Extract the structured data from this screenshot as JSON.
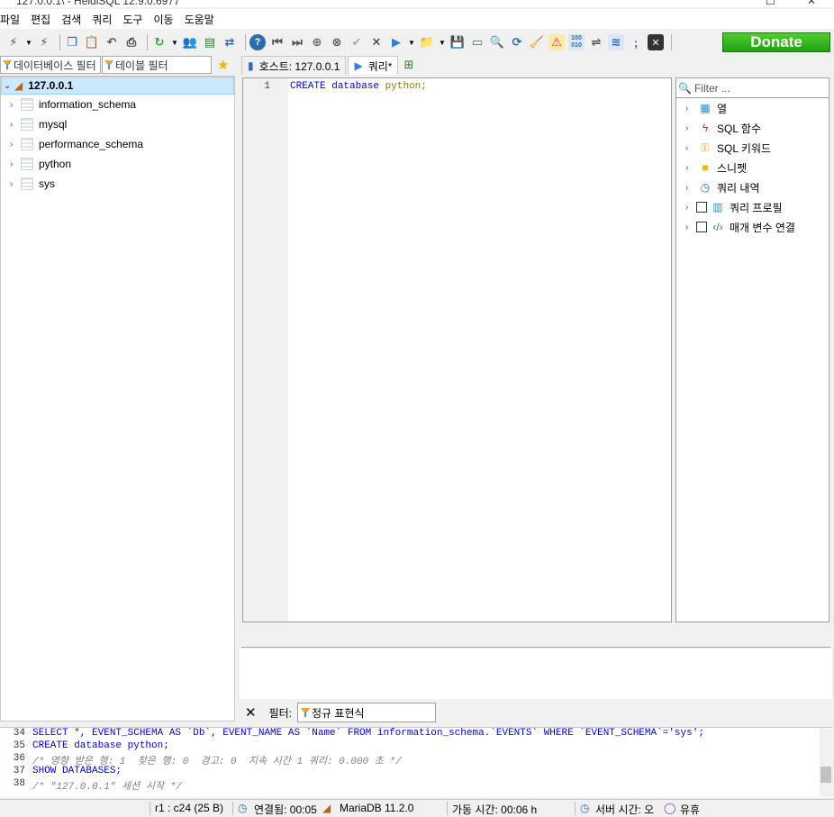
{
  "titlebar": {
    "title": "127.0.0.1\\ - HeidiSQL 12.9.0.6977",
    "restore": "☐",
    "close": "✕"
  },
  "menu": [
    "파일",
    "편집",
    "검색",
    "쿼리",
    "도구",
    "이동",
    "도움말"
  ],
  "toolbar": {
    "donate_label": "Donate"
  },
  "filters": {
    "db_filter": "데이터베이스 필터",
    "table_filter": "테이블 필터"
  },
  "tree": {
    "root": "127.0.0.1",
    "databases": [
      "information_schema",
      "mysql",
      "performance_schema",
      "python",
      "sys"
    ]
  },
  "tabs": {
    "host": "호스트: 127.0.0.1",
    "query": "쿼리*"
  },
  "editor": {
    "line_number": "1",
    "tokens": {
      "k1": "CREATE",
      "k2": "database",
      "id": "python;"
    }
  },
  "side_panel": {
    "filter_placeholder": "Filter ...",
    "items": [
      "열",
      "SQL 함수",
      "SQL 키워드",
      "스니펫",
      "쿼리 내역",
      "쿼리 프로필",
      "매개 변수 연결"
    ]
  },
  "query_filter": {
    "close": "✕",
    "label": "필터:",
    "value": "정규 표현식"
  },
  "log": {
    "lines": [
      {
        "n": "34",
        "text": "SELECT *, EVENT_SCHEMA AS `Db`, EVENT_NAME AS `Name` FROM information_schema.`EVENTS` WHERE `EVENT_SCHEMA`='sys';"
      },
      {
        "n": "35",
        "text": "CREATE database python;"
      },
      {
        "n": "36",
        "text": "/* 영향 받은 행: 1  찾은 행: 0  경고: 0  지속 시간 1 쿼리: 0.000 초 */"
      },
      {
        "n": "37",
        "text": "SHOW DATABASES;"
      },
      {
        "n": "38",
        "text": "/* \"127.0.0.1\" 세션 시작 */"
      }
    ]
  },
  "status": {
    "cursor": "r1 : c24 (25 B)",
    "connected": "연결됨: 00:05",
    "server": "MariaDB 11.2.0",
    "uptime": "가동 시간: 00:06 h",
    "server_time": "서버 시간: 오",
    "idle": "유휴"
  }
}
